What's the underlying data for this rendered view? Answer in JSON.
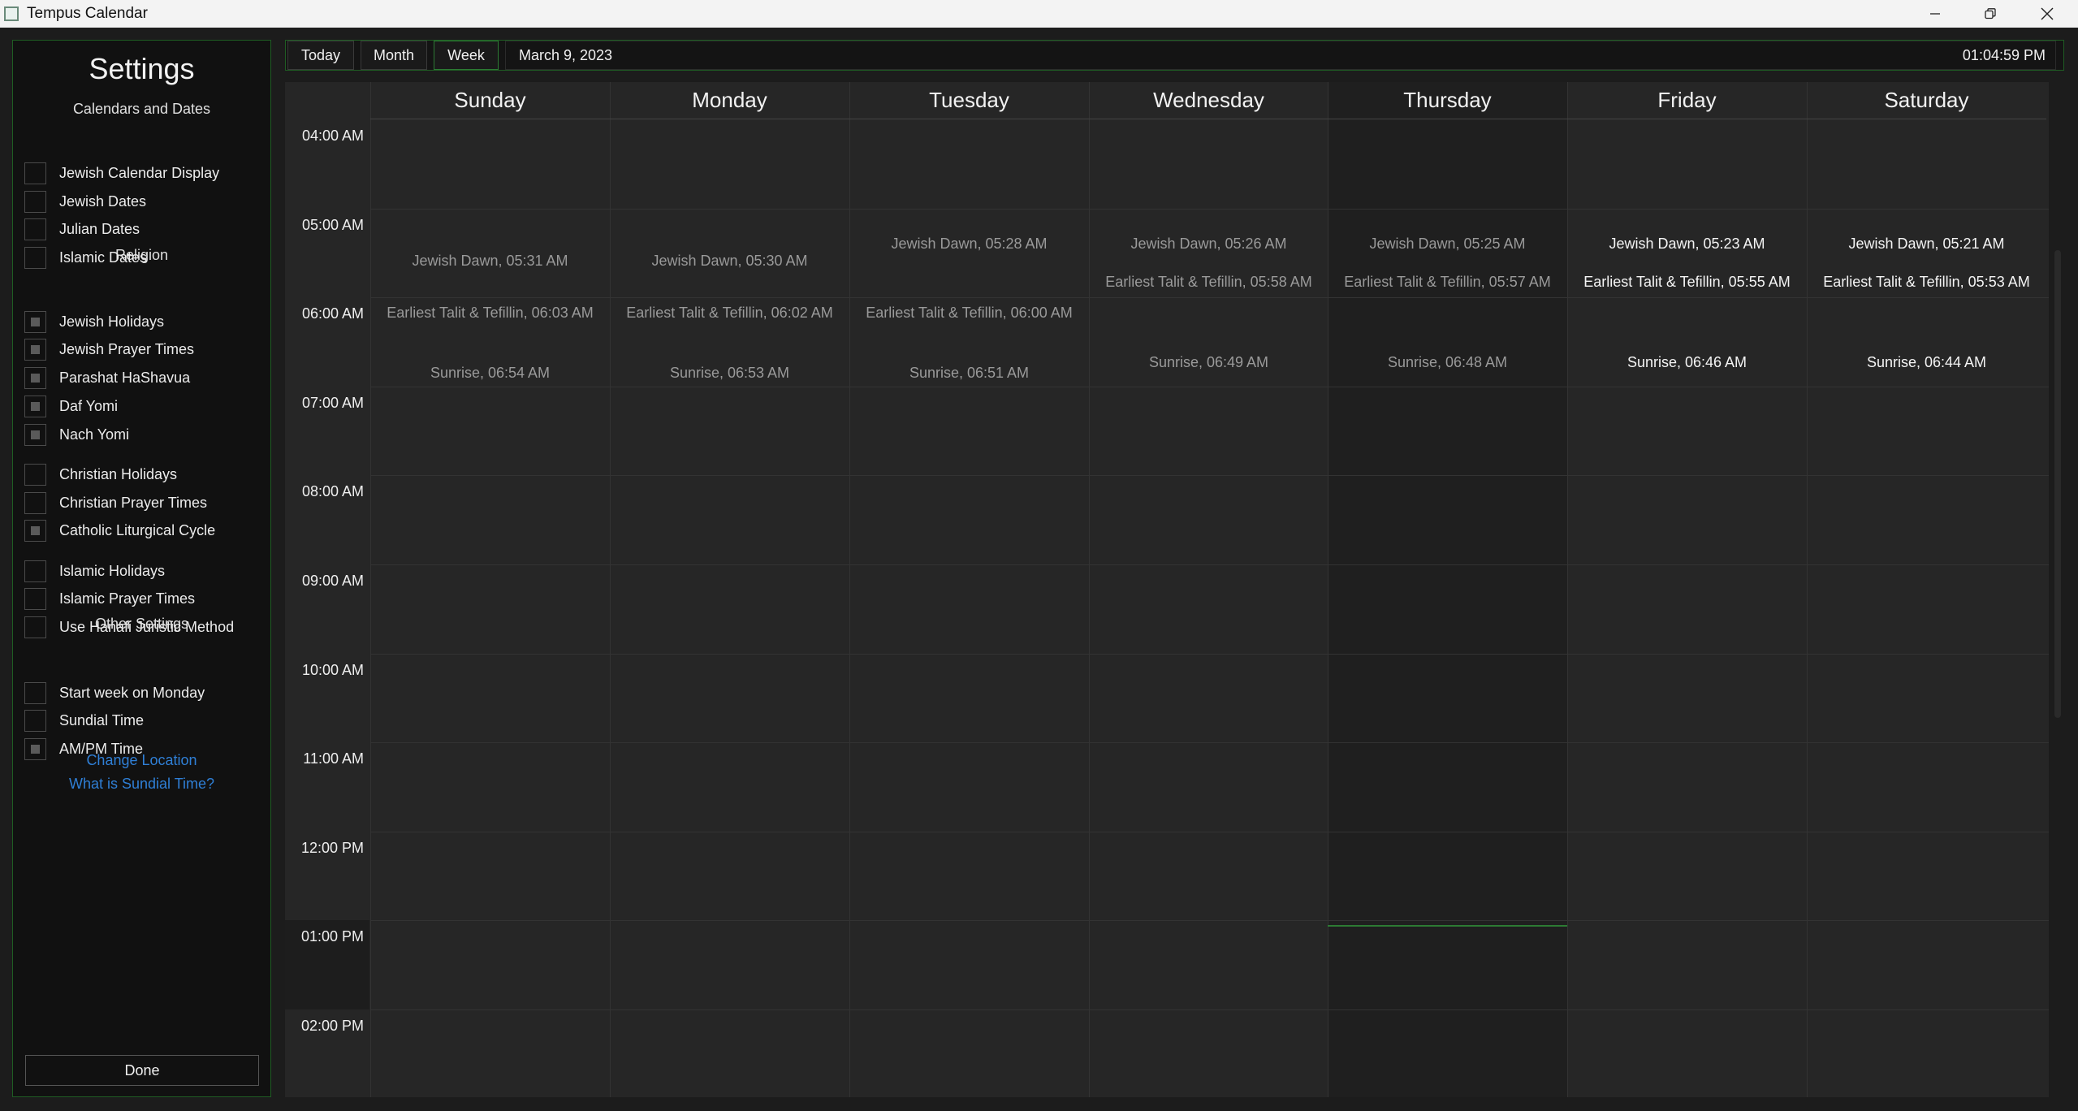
{
  "window": {
    "title": "Tempus Calendar"
  },
  "sidebar": {
    "title": "Settings",
    "sections": {
      "calendars": "Calendars and Dates",
      "religion": "Religion",
      "other": "Other Settings"
    },
    "items": [
      {
        "label": "Jewish Calendar Display",
        "checked": false
      },
      {
        "label": "Jewish Dates",
        "checked": false
      },
      {
        "label": "Julian Dates",
        "checked": false
      },
      {
        "label": "Islamic Dates",
        "checked": false
      },
      {
        "label": "Jewish Holidays",
        "checked": true
      },
      {
        "label": "Jewish Prayer Times",
        "checked": true
      },
      {
        "label": "Parashat HaShavua",
        "checked": true
      },
      {
        "label": "Daf Yomi",
        "checked": true
      },
      {
        "label": "Nach Yomi",
        "checked": true
      },
      {
        "label": "Christian Holidays",
        "checked": false
      },
      {
        "label": "Christian Prayer Times",
        "checked": false
      },
      {
        "label": "Catholic Liturgical Cycle",
        "checked": true
      },
      {
        "label": "Islamic Holidays",
        "checked": false
      },
      {
        "label": "Islamic Prayer Times",
        "checked": false
      },
      {
        "label": "Use Hanafi Juristic Method",
        "checked": false
      },
      {
        "label": "Start week on Monday",
        "checked": false
      },
      {
        "label": "Sundial Time",
        "checked": false
      },
      {
        "label": "AM/PM Time",
        "checked": true
      }
    ],
    "links": {
      "change_location": "Change Location",
      "sundial_help": "What is Sundial Time?"
    },
    "done_label": "Done"
  },
  "toolbar": {
    "today_label": "Today",
    "month_label": "Month",
    "week_label": "Week",
    "current_date": "March 9, 2023",
    "clock": "01:04:59 PM"
  },
  "calendar": {
    "days": [
      "Sunday",
      "Monday",
      "Tuesday",
      "Wednesday",
      "Thursday",
      "Friday",
      "Saturday"
    ],
    "today_index": 4,
    "hours": [
      "04:00 AM",
      "05:00 AM",
      "06:00 AM",
      "07:00 AM",
      "08:00 AM",
      "09:00 AM",
      "10:00 AM",
      "11:00 AM",
      "12:00 PM",
      "01:00 PM",
      "02:00 PM"
    ],
    "current_hour_index": 9,
    "events": [
      {
        "day": 0,
        "text": "Jewish Dawn, 05:31 AM"
      },
      {
        "day": 0,
        "text": "Earliest Talit & Tefillin, 06:03 AM"
      },
      {
        "day": 0,
        "text": "Sunrise, 06:54 AM"
      },
      {
        "day": 1,
        "text": "Jewish Dawn, 05:30 AM"
      },
      {
        "day": 1,
        "text": "Earliest Talit & Tefillin, 06:02 AM"
      },
      {
        "day": 1,
        "text": "Sunrise, 06:53 AM"
      },
      {
        "day": 2,
        "text": "Jewish Dawn, 05:28 AM"
      },
      {
        "day": 2,
        "text": "Earliest Talit & Tefillin, 06:00 AM"
      },
      {
        "day": 2,
        "text": "Sunrise, 06:51 AM"
      },
      {
        "day": 3,
        "text": "Jewish Dawn, 05:26 AM"
      },
      {
        "day": 3,
        "text": "Earliest Talit & Tefillin, 05:58 AM"
      },
      {
        "day": 3,
        "text": "Sunrise, 06:49 AM"
      },
      {
        "day": 4,
        "text": "Jewish Dawn, 05:25 AM"
      },
      {
        "day": 4,
        "text": "Earliest Talit & Tefillin, 05:57 AM"
      },
      {
        "day": 4,
        "text": "Sunrise, 06:48 AM"
      },
      {
        "day": 5,
        "text": "Jewish Dawn, 05:23 AM"
      },
      {
        "day": 5,
        "text": "Earliest Talit & Tefillin, 05:55 AM"
      },
      {
        "day": 5,
        "text": "Sunrise, 06:46 AM"
      },
      {
        "day": 6,
        "text": "Jewish Dawn, 05:21 AM"
      },
      {
        "day": 6,
        "text": "Earliest Talit & Tefillin, 05:53 AM"
      },
      {
        "day": 6,
        "text": "Sunrise, 06:44 AM"
      }
    ]
  },
  "colors": {
    "accent": "#2c7a33",
    "link": "#2f7fd6"
  },
  "icons": {
    "app": "calendar-app-icon",
    "minimize": "minimize-icon",
    "maximize": "restore-icon",
    "close": "close-icon"
  }
}
